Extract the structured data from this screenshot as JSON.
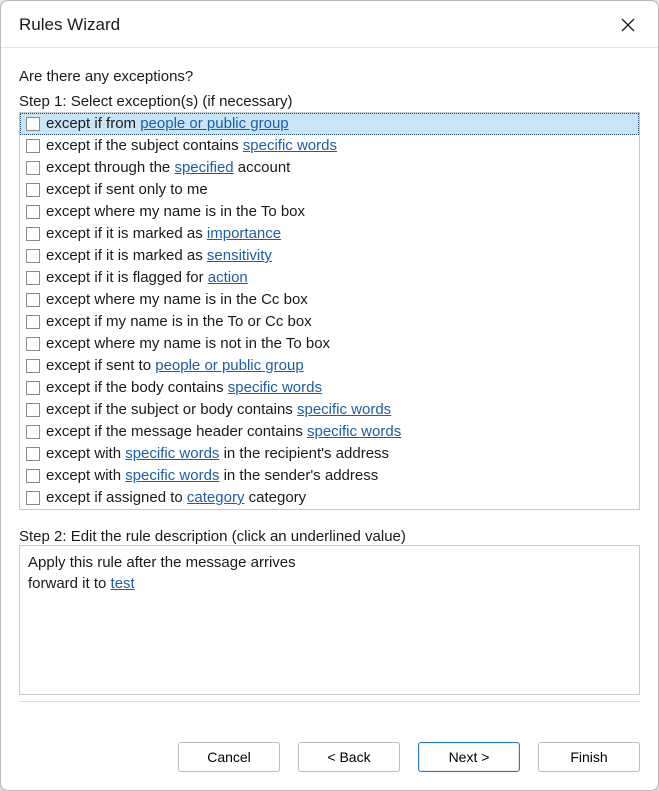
{
  "window": {
    "title": "Rules Wizard"
  },
  "heading": "Are there any exceptions?",
  "step1_label": "Step 1: Select exception(s) (if necessary)",
  "step2_label": "Step 2: Edit the rule description (click an underlined value)",
  "exceptions": [
    {
      "selected": true,
      "segments": [
        {
          "t": "except if from "
        },
        {
          "t": "people or public group",
          "link": true
        }
      ]
    },
    {
      "selected": false,
      "segments": [
        {
          "t": "except if the subject contains "
        },
        {
          "t": "specific words",
          "link": true
        }
      ]
    },
    {
      "selected": false,
      "segments": [
        {
          "t": "except through the "
        },
        {
          "t": "specified",
          "link": true
        },
        {
          "t": " account"
        }
      ]
    },
    {
      "selected": false,
      "segments": [
        {
          "t": "except if sent only to me"
        }
      ]
    },
    {
      "selected": false,
      "segments": [
        {
          "t": "except where my name is in the To box"
        }
      ]
    },
    {
      "selected": false,
      "segments": [
        {
          "t": "except if it is marked as "
        },
        {
          "t": "importance",
          "link": true
        }
      ]
    },
    {
      "selected": false,
      "segments": [
        {
          "t": "except if it is marked as "
        },
        {
          "t": "sensitivity",
          "link": true
        }
      ]
    },
    {
      "selected": false,
      "segments": [
        {
          "t": "except if it is flagged for "
        },
        {
          "t": "action",
          "link": true
        }
      ]
    },
    {
      "selected": false,
      "segments": [
        {
          "t": "except where my name is in the Cc box"
        }
      ]
    },
    {
      "selected": false,
      "segments": [
        {
          "t": "except if my name is in the To or Cc box"
        }
      ]
    },
    {
      "selected": false,
      "segments": [
        {
          "t": "except where my name is not in the To box"
        }
      ]
    },
    {
      "selected": false,
      "segments": [
        {
          "t": "except if sent to "
        },
        {
          "t": "people or public group",
          "link": true
        }
      ]
    },
    {
      "selected": false,
      "segments": [
        {
          "t": "except if the body contains "
        },
        {
          "t": "specific words",
          "link": true
        }
      ]
    },
    {
      "selected": false,
      "segments": [
        {
          "t": "except if the subject or body contains "
        },
        {
          "t": "specific words",
          "link": true
        }
      ]
    },
    {
      "selected": false,
      "segments": [
        {
          "t": "except if the message header contains "
        },
        {
          "t": "specific words",
          "link": true
        }
      ]
    },
    {
      "selected": false,
      "segments": [
        {
          "t": "except with "
        },
        {
          "t": "specific words",
          "link": true
        },
        {
          "t": " in the recipient's address"
        }
      ]
    },
    {
      "selected": false,
      "segments": [
        {
          "t": "except with "
        },
        {
          "t": "specific words",
          "link": true
        },
        {
          "t": " in the sender's address"
        }
      ]
    },
    {
      "selected": false,
      "segments": [
        {
          "t": "except if assigned to "
        },
        {
          "t": "category",
          "link": true
        },
        {
          "t": " category"
        }
      ]
    }
  ],
  "description": {
    "line1": "Apply this rule after the message arrives",
    "line2_prefix": "forward it to ",
    "line2_link": "test"
  },
  "buttons": {
    "cancel": "Cancel",
    "back": "< Back",
    "next": "Next >",
    "finish": "Finish"
  }
}
